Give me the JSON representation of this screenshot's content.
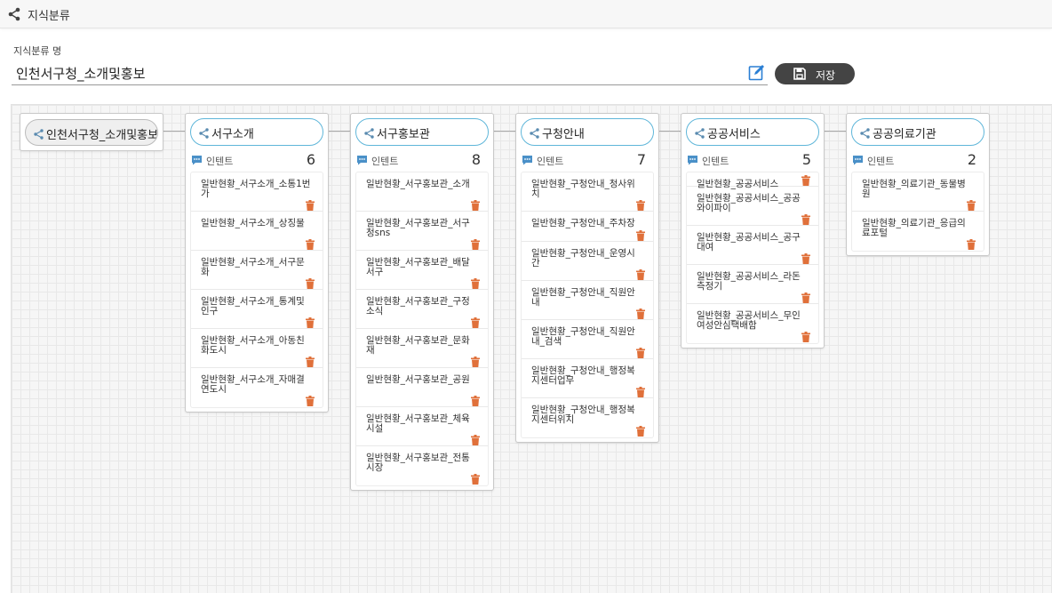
{
  "header": {
    "title": "지식분류",
    "icon": "share-icon"
  },
  "form": {
    "label": "지식분류 명",
    "value": "인천서구청_소개및홍보",
    "save_label": "저장"
  },
  "root": {
    "label": "인천서구청_소개및홍보"
  },
  "intent_label": "인텐트",
  "columns": [
    {
      "name": "서구소개",
      "count": "6",
      "items": [
        "일반현황_서구소개_소통1번가",
        "일반현황_서구소개_상징물",
        "일반현황_서구소개_서구문화",
        "일반현황_서구소개_통계및인구",
        "일반현황_서구소개_아동친화도시",
        "일반현황_서구소개_자매결연도시"
      ]
    },
    {
      "name": "서구홍보관",
      "count": "8",
      "items": [
        "일반현황_서구홍보관_소개",
        "일반현황_서구홍보관_서구청sns",
        "일반현황_서구홍보관_배달서구",
        "일반현황_서구홍보관_구정소식",
        "일반현황_서구홍보관_문화재",
        "일반현황_서구홍보관_공원",
        "일반현황_서구홍보관_체육시설",
        "일반현황_서구홍보관_전통시장"
      ]
    },
    {
      "name": "구청안내",
      "count": "7",
      "items": [
        "일반현황_구청안내_청사위치",
        "일반현황_구청안내_주차장",
        "일반현황_구청안내_운영시간",
        "일반현황_구청안내_직원안내",
        "일반현황_구청안내_직원안내_검색",
        "일반현황_구청안내_행정복지센터업무",
        "일반현황_구청안내_행정복지센터위치"
      ]
    },
    {
      "name": "공공서비스",
      "count": "5",
      "items": [
        "일반현황_공공서비스",
        "일반현황_공공서비스_공공와이파이",
        "일반현황_공공서비스_공구대여",
        "일반현황_공공서비스_라돈측정기",
        "일반현황_공공서비스_무인여성안심택배함"
      ]
    },
    {
      "name": "공공의료기관",
      "count": "2",
      "items": [
        "일반현황_의료기관_동물병원",
        "일반현황_의료기관_응급의료포털"
      ]
    }
  ],
  "colors": {
    "accent": "#5fb6d9",
    "delete": "#e0703a",
    "button": "#444444",
    "edit": "#2a7fd4"
  }
}
